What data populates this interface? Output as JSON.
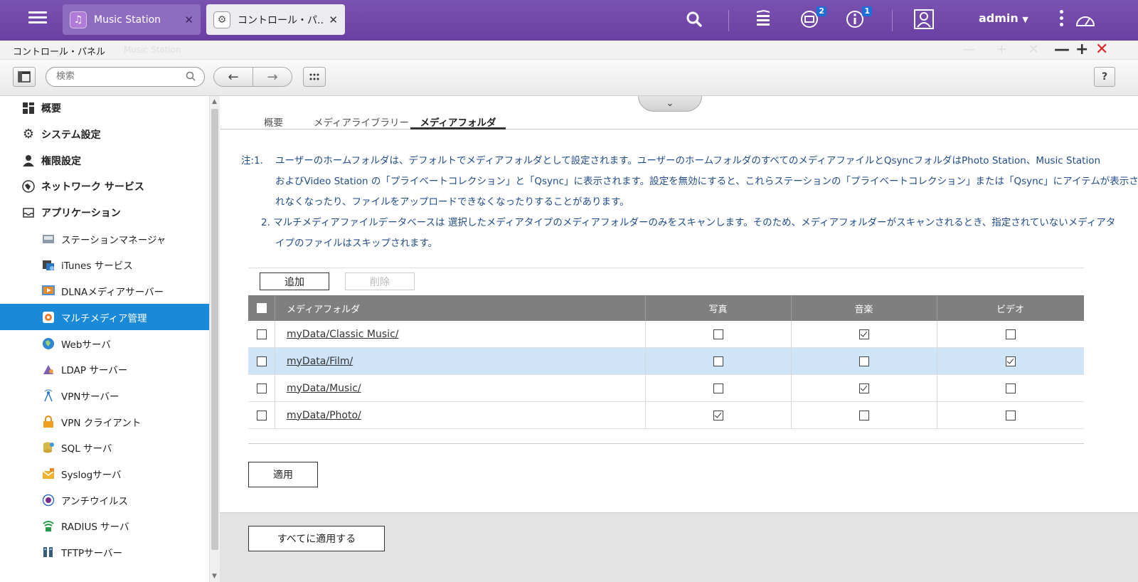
{
  "topbar": {
    "tabs": [
      {
        "label": "Music Station",
        "icon": "music-note-icon"
      },
      {
        "label": "コントロール・パ...",
        "icon": "gear-icon"
      }
    ],
    "notifications_badge": "2",
    "info_badge": "1",
    "user": "admin"
  },
  "window": {
    "title": "コントロール・パネル",
    "ghost_title": "Music Station"
  },
  "toolbar": {
    "search_placeholder": "検索",
    "help_label": "?"
  },
  "sidebar": {
    "items": [
      {
        "label": "概要",
        "icon": "overview-grid-icon",
        "level": "top"
      },
      {
        "label": "システム設定",
        "icon": "gear-icon",
        "level": "top"
      },
      {
        "label": "権限設定",
        "icon": "user-icon",
        "level": "top"
      },
      {
        "label": "ネットワーク サービス",
        "icon": "network-globe-icon",
        "level": "top"
      },
      {
        "label": "アプリケーション",
        "icon": "application-tray-icon",
        "level": "top"
      },
      {
        "label": "ステーションマネージャ",
        "icon": "station-manager-icon",
        "level": "sub"
      },
      {
        "label": "iTunes サービス",
        "icon": "itunes-icon",
        "level": "sub"
      },
      {
        "label": "DLNAメディアサーバー",
        "icon": "dlna-icon",
        "level": "sub"
      },
      {
        "label": "マルチメディア管理",
        "icon": "multimedia-icon",
        "level": "sub",
        "active": true
      },
      {
        "label": "Webサーバ",
        "icon": "web-globe-icon",
        "level": "sub"
      },
      {
        "label": "LDAP サーバー",
        "icon": "ldap-icon",
        "level": "sub"
      },
      {
        "label": "VPNサーバー",
        "icon": "vpn-antenna-icon",
        "level": "sub"
      },
      {
        "label": "VPN クライアント",
        "icon": "vpn-lock-icon",
        "level": "sub"
      },
      {
        "label": "SQL サーバ",
        "icon": "database-icon",
        "level": "sub"
      },
      {
        "label": "Syslogサーバ",
        "icon": "syslog-envelope-icon",
        "level": "sub"
      },
      {
        "label": "アンチウイルス",
        "icon": "antivirus-icon",
        "level": "sub"
      },
      {
        "label": "RADIUS サーバ",
        "icon": "radius-icon",
        "level": "sub"
      },
      {
        "label": "TFTPサーバー",
        "icon": "tftp-icon",
        "level": "sub"
      }
    ]
  },
  "main": {
    "tabs": [
      {
        "label": "概要"
      },
      {
        "label": "メディアライブラリー"
      },
      {
        "label": "メディアフォルダ",
        "active": true
      }
    ],
    "note_prefix": "注:1.",
    "note1_line1": "ユーザーのホームフォルダは、デフォルトでメディアフォルダとして設定されます。ユーザーのホームフォルダのすべてのメディアファイルとQsyncフォルダはPhoto Station、Music Station",
    "note1_line2": "およびVideo Station の「プライベートコレクション」と「Qsync」に表示されます。設定を無効にすると、これらステーションの「プライベートコレクション」または「Qsync」にアイテムが表示さ",
    "note1_line3": "れなくなったり、ファイルをアップロードできなくなったりすることがあります。",
    "note2_line1": "2. マルチメディアファイルデータベースは 選択したメディアタイプのメディアフォルダーのみをスキャンします。そのため、メディアフォルダーがスキャンされるとき、指定されていないメディアタ",
    "note2_line2": "イプのファイルはスキップされます。",
    "add_button": "追加",
    "delete_button": "削除",
    "table": {
      "headers": [
        "メディアフォルダ",
        "写真",
        "音楽",
        "ビデオ"
      ],
      "rows": [
        {
          "folder": "myData/Classic Music/",
          "photo": false,
          "music": true,
          "video": false,
          "selected": false
        },
        {
          "folder": "myData/Film/",
          "photo": false,
          "music": false,
          "video": true,
          "selected": true
        },
        {
          "folder": "myData/Music/",
          "photo": false,
          "music": true,
          "video": false,
          "selected": false
        },
        {
          "folder": "myData/Photo/",
          "photo": true,
          "music": false,
          "video": false,
          "selected": false
        }
      ]
    },
    "apply_button": "適用",
    "apply_all_button": "すべてに適用する"
  }
}
